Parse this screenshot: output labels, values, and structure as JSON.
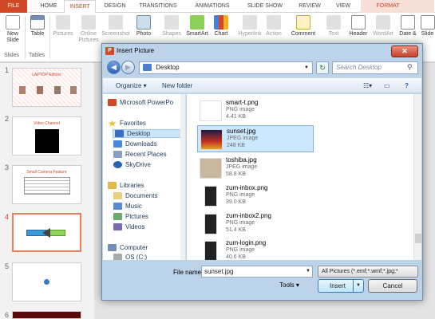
{
  "ribbon_tabs": [
    "FILE",
    "HOME",
    "INSERT",
    "DESIGN",
    "TRANSITIONS",
    "ANIMATIONS",
    "SLIDE SHOW",
    "REVIEW",
    "VIEW",
    "FORMAT"
  ],
  "ribbon": {
    "new_slide": "New\nSlide",
    "table": "Table",
    "pictures": "Pictures",
    "online_pictures": "Online\nPictures",
    "screenshot": "Screenshot",
    "photo": "Photo",
    "shapes": "Shapes",
    "smartart": "SmartArt",
    "chart": "Chart",
    "hyperlink": "Hyperlink",
    "action": "Action",
    "comment": "Comment",
    "text": "Text",
    "header": "Header",
    "wordart": "WordArt",
    "date": "Date &",
    "slide": "Slide",
    "group_slides": "Slides",
    "group_tables": "Tables"
  },
  "slides": [
    {
      "num": "1",
      "title": "LAPTOP Editors"
    },
    {
      "num": "2",
      "title": "Video Channel"
    },
    {
      "num": "3",
      "title": "Small Camera Feature"
    },
    {
      "num": "4",
      "title": ""
    },
    {
      "num": "5",
      "title": ""
    },
    {
      "num": "6",
      "title": ""
    }
  ],
  "dialog": {
    "title": "Insert Picture",
    "close": "✕",
    "address": "Desktop",
    "search_placeholder": "Search Desktop",
    "organize": "Organize ▾",
    "new_folder": "New folder",
    "nav": {
      "microsoft_powerpoint": "Microsoft PowerPo",
      "favorites": "Favorites",
      "desktop": "Desktop",
      "downloads": "Downloads",
      "recent_places": "Recent Places",
      "skydrive": "SkyDrive",
      "libraries": "Libraries",
      "documents": "Documents",
      "music": "Music",
      "pictures": "Pictures",
      "videos": "Videos",
      "computer": "Computer",
      "os_c": "OS (C:)"
    },
    "files": [
      {
        "name": "smart-t.png",
        "type": "PNG image",
        "size": "4.41 KB"
      },
      {
        "name": "sunset.jpg",
        "type": "JPEG image",
        "size": "248 KB"
      },
      {
        "name": "toshiba.jpg",
        "type": "JPEG image",
        "size": "58.8 KB"
      },
      {
        "name": "zum-inbox.png",
        "type": "PNG image",
        "size": "39.0 KB"
      },
      {
        "name": "zum-inbox2.png",
        "type": "PNG image",
        "size": "51.4 KB"
      },
      {
        "name": "zum-login.png",
        "type": "PNG image",
        "size": "40.6 KB"
      }
    ],
    "file_name_label": "File name:",
    "file_name_value": "sunset.jpg",
    "filter": "All Pictures (*.emf;*.wmf;*.jpg;*",
    "tools": "Tools",
    "insert": "Insert",
    "cancel": "Cancel"
  }
}
